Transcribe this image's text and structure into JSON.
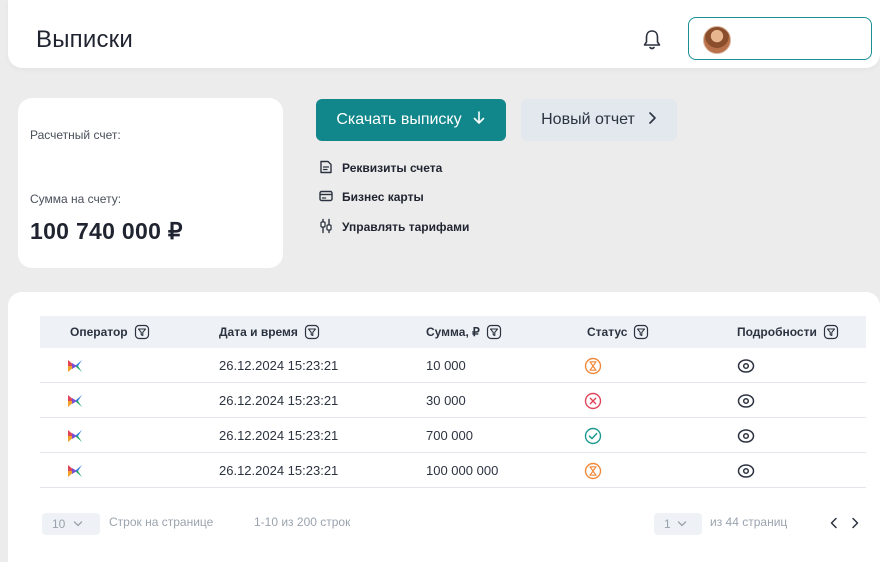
{
  "header": {
    "title": "Выписки",
    "icons": {
      "bell": "bell-icon",
      "avatar": "user-avatar"
    }
  },
  "account": {
    "account_label": "Расчетный счет:",
    "balance_label": "Сумма на счету:",
    "balance": "100 740 000 ₽"
  },
  "actions": {
    "download_label": "Скачать выписку",
    "download_icon": "arrow-down-icon",
    "new_report_label": "Новый отчет",
    "new_report_icon": "chevron-right-icon"
  },
  "links": [
    {
      "label": "Реквизиты счета",
      "icon": "document-icon"
    },
    {
      "label": "Бизнес карты",
      "icon": "card-icon"
    },
    {
      "label": "Управлять тарифами",
      "icon": "sliders-icon"
    }
  ],
  "table": {
    "columns": [
      "Оператор",
      "Дата и время",
      "Сумма, ₽",
      "Статус",
      "Подробности"
    ],
    "rows": [
      {
        "operator": "operator-logo",
        "datetime": "26.12.2024 15:23:21",
        "amount": "10 000",
        "status": "pending",
        "details": "eye-icon"
      },
      {
        "operator": "operator-logo",
        "datetime": "26.12.2024 15:23:21",
        "amount": "30 000",
        "status": "failed",
        "details": "eye-icon"
      },
      {
        "operator": "operator-logo",
        "datetime": "26.12.2024 15:23:21",
        "amount": "700 000",
        "status": "success",
        "details": "eye-icon"
      },
      {
        "operator": "operator-logo",
        "datetime": "26.12.2024 15:23:21",
        "amount": "100 000 000",
        "status": "pending",
        "details": "eye-icon"
      }
    ]
  },
  "pagination": {
    "rows_per_page_value": "10",
    "rows_per_page_label": "Строк на странице",
    "range_text": "1-10 из 200 строк",
    "page_value": "1",
    "total_pages_text": "из 44 страниц"
  },
  "colors": {
    "accent": "#12878b",
    "status_pending": "#f08a3c",
    "status_failed": "#e0455a",
    "status_success": "#1c9a8e"
  }
}
